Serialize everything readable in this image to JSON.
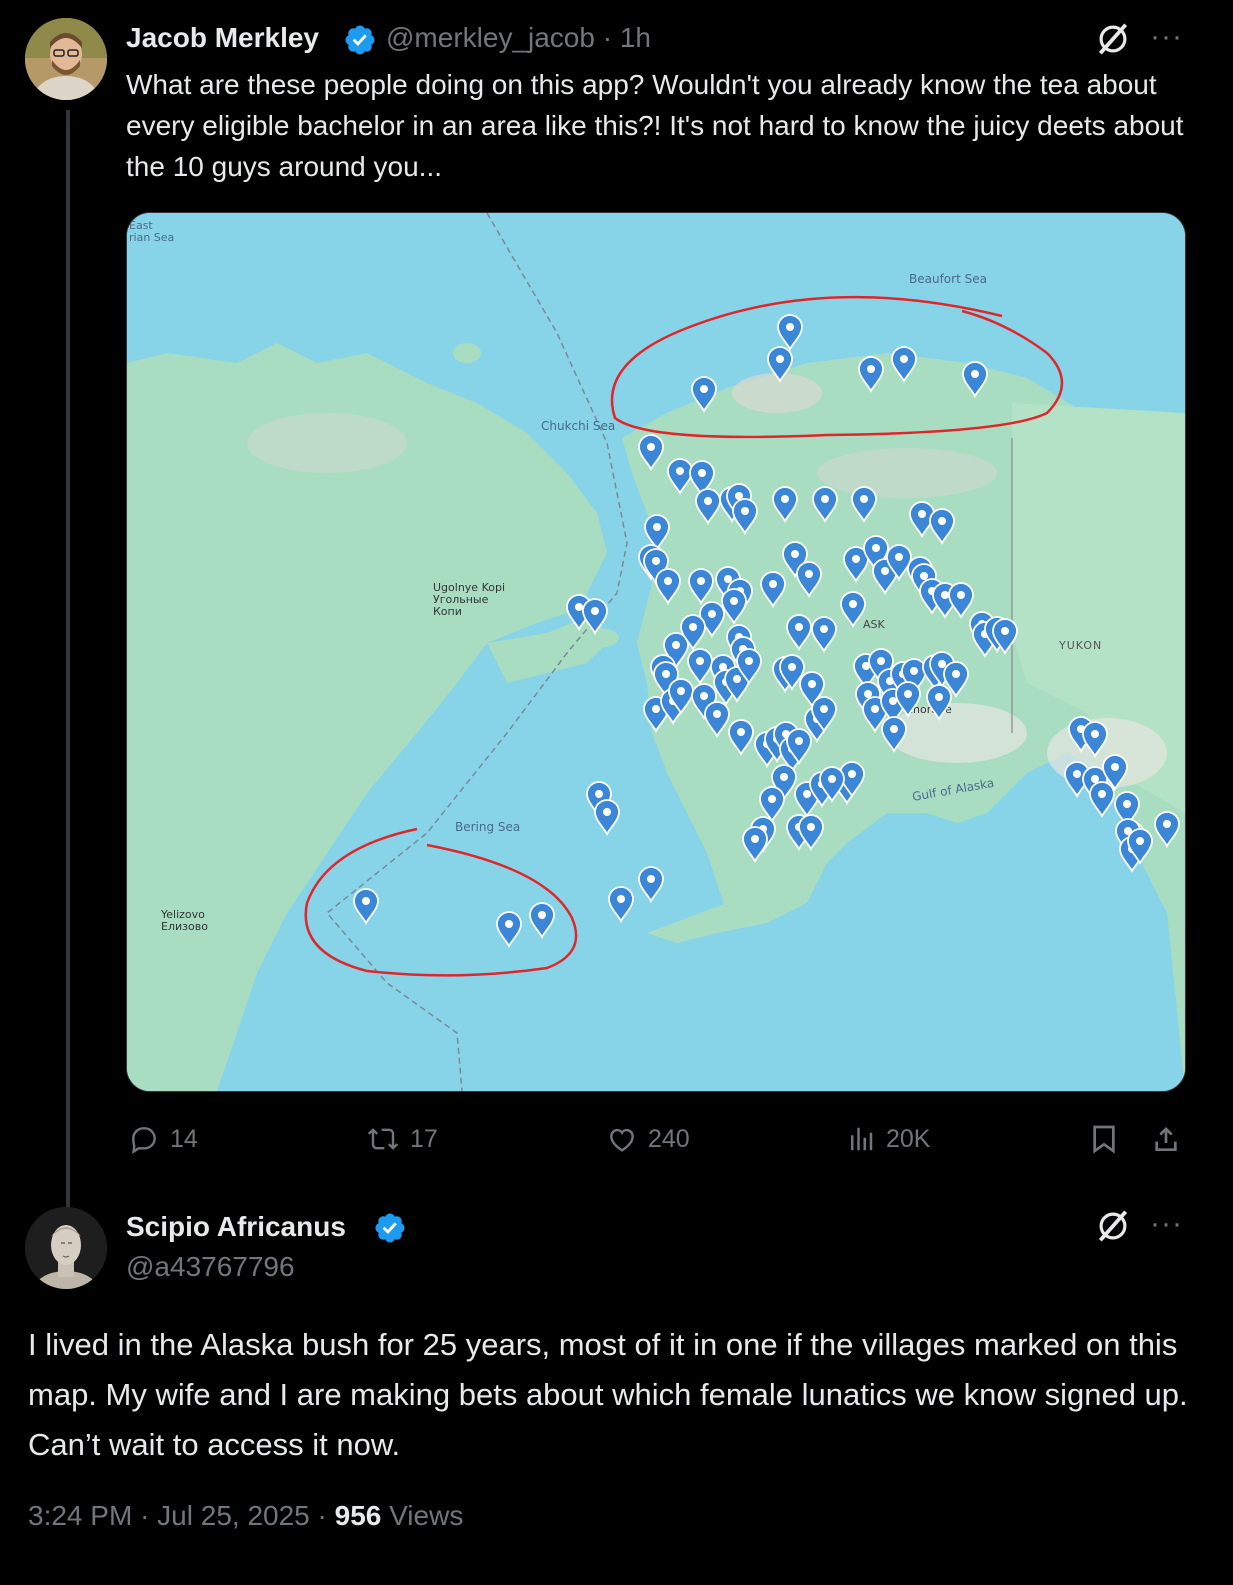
{
  "tweet1": {
    "author_name": "Jacob Merkley",
    "author_handle": "@merkley_jacob",
    "separator": "·",
    "time": "1h",
    "text": "What are these people doing on this app? Wouldn't you already know the tea about every eligible bachelor in an area like this?! It's not hard to know the juicy deets about the 10 guys around you...",
    "map_labels": {
      "east_siberian": "East\nSiberian Sea",
      "beaufort": "Beaufort Sea",
      "chukchi": "Chukchi Sea",
      "ugolnye_latin": "Ugolnye Kopi",
      "ugolnye_cyr1": "Угольные",
      "ugolnye_cyr2": "Копи",
      "yukon": "YUKON",
      "bering": "Bering Sea",
      "gulf": "Gulf of Alaska",
      "yelizovo_latin": "Yelizovo",
      "yelizovo_cyr": "Елизово",
      "alaska_partial": "ASK",
      "anchorage_partial": "chorage"
    },
    "actions": {
      "replies": "14",
      "reposts": "17",
      "likes": "240",
      "views": "20K"
    },
    "colors": {
      "verified": "#1d9bf0",
      "pin": "#3b86d6",
      "annotation": "#e0262b"
    }
  },
  "tweet2": {
    "author_name": "Scipio Africanus",
    "author_handle": "@a43767796",
    "text": "I lived in the Alaska bush for 25 years, most of it in one if the villages marked on this map. My wife and I are making bets about which female lunatics we know signed up. Can’t wait to access it now.",
    "time": "3:24 PM",
    "date": "Jul 25, 2025",
    "views_count": "956",
    "views_label": "Views"
  },
  "icons": {
    "menu": "more-icon",
    "grok": "grok-icon",
    "reply": "reply-icon",
    "repost": "repost-icon",
    "like": "like-icon",
    "views": "views-icon",
    "bookmark": "bookmark-icon",
    "share": "share-icon"
  }
}
